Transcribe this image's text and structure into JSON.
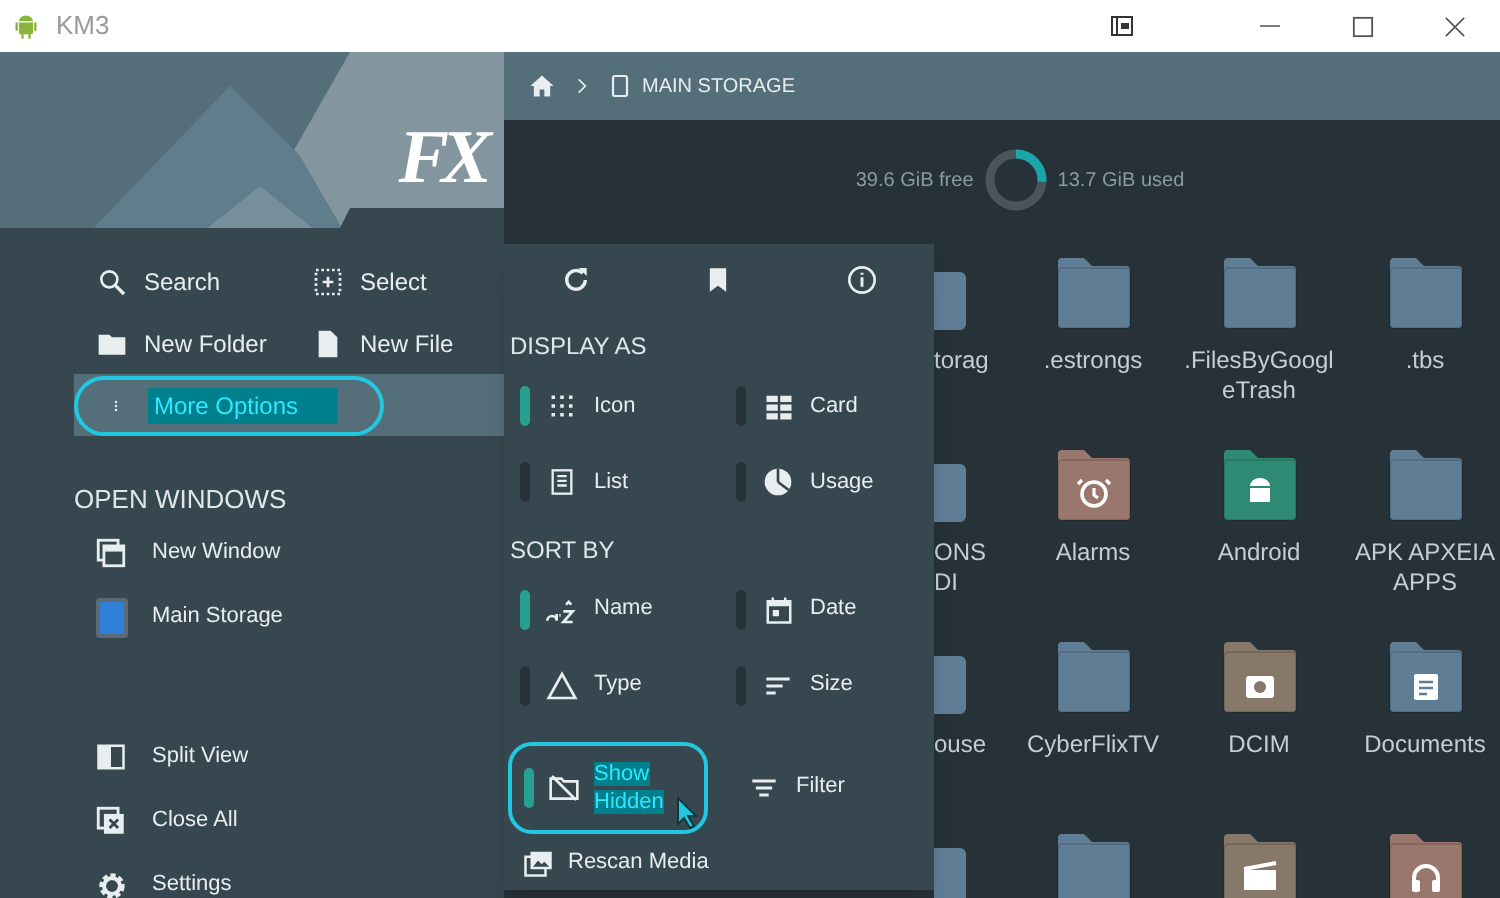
{
  "window": {
    "title": "KM3"
  },
  "sidebar": {
    "logo": "FX",
    "actions": [
      {
        "label": "Search",
        "highlighted": false
      },
      {
        "label": "Select",
        "highlighted": false
      },
      {
        "label": "New Folder",
        "highlighted": false
      },
      {
        "label": "New File",
        "highlighted": false
      },
      {
        "label": "More Options",
        "highlighted": true
      }
    ],
    "open_windows": {
      "heading": "OPEN WINDOWS",
      "items": [
        "New Window",
        "Main Storage"
      ]
    },
    "bottom_items": [
      "Split View",
      "Close All",
      "Settings"
    ]
  },
  "breadcrumb": [
    "MAIN STORAGE"
  ],
  "storage": {
    "free": "39.6 GiB free",
    "used": "13.7 GiB used",
    "level": 0.26
  },
  "folders": [
    {
      "label": "torag",
      "color": "#5f7d95",
      "partial": true
    },
    {
      "label": ".estrongs",
      "color": "#5f7d95"
    },
    {
      "label": ".FilesByGoogleTrash",
      "color": "#5f7d95"
    },
    {
      "label": ".tbs",
      "color": "#5f7d95"
    },
    {
      "label": "ONS DI",
      "color": "#5f7d95",
      "partial": true
    },
    {
      "label": "Alarms",
      "color": "#9a776d",
      "kind": "alarm"
    },
    {
      "label": "Android",
      "color": "#2e8a73",
      "kind": "android"
    },
    {
      "label": "APK APXEIA APPS",
      "color": "#5f7d95"
    },
    {
      "label": "ouse",
      "color": "#5f7d95",
      "partial": true
    },
    {
      "label": "CyberFlixTV",
      "color": "#5f7d95"
    },
    {
      "label": "DCIM",
      "color": "#86796a",
      "kind": "camera"
    },
    {
      "label": "Documents",
      "color": "#5f7d95",
      "kind": "document"
    },
    {
      "color": "#5f7d95",
      "partial": true
    },
    {
      "color": "#5f7d95"
    },
    {
      "color": "#86796a",
      "kind": "movie"
    },
    {
      "color": "#9a776d",
      "kind": "music"
    }
  ],
  "menu": {
    "sections": [
      {
        "heading": "DISPLAY AS",
        "options": [
          {
            "label": "Icon",
            "selected": true
          },
          {
            "label": "Card",
            "selected": false
          },
          {
            "label": "List",
            "selected": false
          },
          {
            "label": "Usage",
            "selected": false
          }
        ]
      },
      {
        "heading": "SORT BY",
        "options": [
          {
            "label": "Name",
            "selected": true
          },
          {
            "label": "Date",
            "selected": false
          },
          {
            "label": "Type",
            "selected": false
          },
          {
            "label": "Size",
            "selected": false
          }
        ]
      }
    ],
    "toggles": [
      {
        "kind": "toggle",
        "label": "Show Hidden",
        "on": true,
        "highlighted": true
      },
      {
        "kind": "action",
        "label": "Filter"
      }
    ],
    "actions": [
      "Rescan Media"
    ]
  }
}
